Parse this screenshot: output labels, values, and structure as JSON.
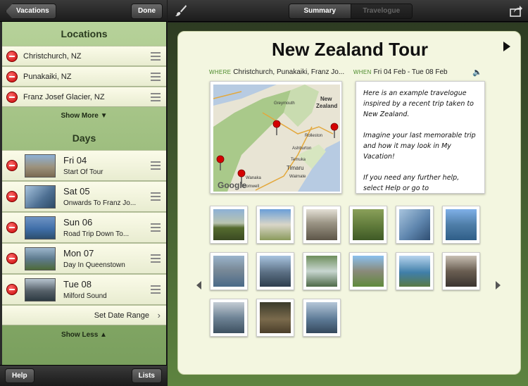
{
  "nav": {
    "back_label": "Vacations",
    "done_label": "Done"
  },
  "locations": {
    "header": "Locations",
    "items": [
      {
        "label": "Christchurch, NZ"
      },
      {
        "label": "Punakaiki, NZ"
      },
      {
        "label": "Franz Josef Glacier, NZ"
      }
    ],
    "show_more": "Show More ▼"
  },
  "days": {
    "header": "Days",
    "items": [
      {
        "day": "Fri 04",
        "desc": "Start Of Tour"
      },
      {
        "day": "Sat 05",
        "desc": "Onwards To Franz Jo..."
      },
      {
        "day": "Sun 06",
        "desc": "Road Trip Down To..."
      },
      {
        "day": "Mon 07",
        "desc": "Day In Queenstown"
      },
      {
        "day": "Tue 08",
        "desc": "Milford Sound"
      }
    ],
    "date_range": "Set Date Range",
    "show_less": "Show Less ▲"
  },
  "bottom": {
    "help_label": "Help",
    "lists_label": "Lists"
  },
  "tabs": {
    "summary": "Summary",
    "travelogue": "Travelogue"
  },
  "trip": {
    "title": "New Zealand Tour",
    "where_label": "WHERE",
    "where_value": "Christchurch, Punakaiki, Franz Jo...",
    "when_label": "WHEN",
    "when_value": "Fri 04 Feb - Tue 08 Feb"
  },
  "map": {
    "attribution": "Google",
    "labels": [
      "Greymouth",
      "New",
      "Zealand",
      "Rolleston",
      "Ashburton",
      "Temuka",
      "Timaru",
      "Waimate",
      "Wanaka",
      "Cromwell"
    ]
  },
  "note": [
    "Here is an example travelogue inspired by a recent trip taken to New Zealand.",
    "Imagine your last memorable trip and how it may look in My Vacation!",
    "If you need any further help, select Help or go to"
  ],
  "photos": [
    {
      "color": "#7c8f4a"
    },
    {
      "color": "#6a8fb8"
    },
    {
      "color": "#8a8574"
    },
    {
      "color": "#6f8a3e"
    },
    {
      "color": "#5f86ae"
    },
    {
      "color": "#3f6ea8"
    },
    {
      "color": "#5a7896"
    },
    {
      "color": "#7e98b6"
    },
    {
      "color": "#6e8e5c"
    },
    {
      "color": "#6f9a4c"
    },
    {
      "color": "#3f7ea8"
    },
    {
      "color": "#5b5048"
    },
    {
      "color": "#6f8496"
    },
    {
      "color": "#6a5a3c"
    },
    {
      "color": "#5d7a96"
    }
  ],
  "colors": {
    "accent_green": "#4a8a2a",
    "delete_red": "#c40000"
  }
}
